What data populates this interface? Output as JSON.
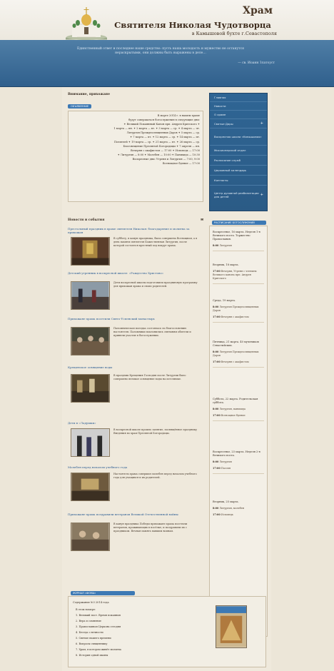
{
  "header": {
    "title": "Храм",
    "name": "Святителя Николая Чудотворца",
    "place": "в Камышовой бухте г.Севастополя",
    "quote": "Единственный ответ и последнее наше средство: пусть наша молодость и мужество не останутся нераскрытыми, они должны быть выражены в деле…",
    "quote_author": "— св. Иоанн Златоуст"
  },
  "notice": {
    "title": "Внимание, прихожане",
    "tab": "ОБЪЯВЛЕНИЕ",
    "lines": [
      "В марте 2014 г. в нашем храме",
      "будут совершаться богослужения в следующие дни:",
      "✦ Великий Покаянный Канон прп. Андрея Критского ✦",
      "1 марта — пн. ✦ 2 марта — вт. ✦ 3 марта — ср. ✦ 4 марта — чт.",
      "Литургия Преждеосвященных Даров ✦ 5 марта — ср.",
      "✦ 7 марта — пт. ✦ 12 марта — ср. ✦ 14 марта — пт.",
      "Полиелей ✦ 19 марта — ср. ✦ 21 марта — пт. ✦ 26 марта — ср.",
      "Благовещение Пресвятой Богородицы ✦ 7 апреля — пн.",
      "Вечерня с акафистом — 17:00 ✦ Исповедь — 17:00",
      "✦ Литургия — 8:00 ✦ Молебен — 10:00 ✦ Панихида — 10:30",
      "Воскресные дни: Утреня и Литургия — 7:00, 9:00",
      "Всенощное бдение — 17:00"
    ]
  },
  "news": {
    "title": "Новости и события",
    "rss": "✉",
    "items": [
      {
        "title": "Престольный праздник в храме святителя Николая: благодарение и молитва за прихожан",
        "text": "В субботу, в канун праздника, была совершена Всенощная, а в день памяти святителя Божественная Литургия, после которой состоялся крестный ход вокруг храма."
      },
      {
        "title": "Детский утренник в воскресной школе: «Рождество Христово»",
        "text": "Дети воскресной школы подготовили праздничную программу для прихожан храма и своих родителей."
      },
      {
        "title": "Прихожане храма посетили Свято-Успенский монастырь",
        "text": "Паломническая поездка состоялась по благословению настоятеля. Паломники поклонились святыням обители и приняли участие в богослужении."
      },
      {
        "title": "Крещенское освящение воды",
        "text": "В праздник Крещения Господня после Литургии было совершено великое освящение воды на источнике."
      },
      {
        "title": "Дети в «Ладушки»",
        "text": "В воскресной школе прошло занятие, посвящённое празднику Введения во храм Пресвятой Богородицы."
      },
      {
        "title": "Молебен перед началом учебного года",
        "text": "Настоятель храма совершил молебен перед началом учебного года для учащихся и их родителей."
      },
      {
        "title": "Прихожане храма поздравили ветеранов Великой Отечественной войны",
        "text": "В канун праздника Победы прихожане храма посетили ветеранов, проживающих в посёлке, и поздравили их с праздником. Вечная память павшим воинам."
      }
    ]
  },
  "nav": {
    "items": [
      {
        "label": "Главная",
        "plus": ""
      },
      {
        "label": "Новости",
        "plus": ""
      },
      {
        "label": "О храме",
        "plus": ""
      },
      {
        "label": "Святые Дары",
        "plus": "+"
      },
      {
        "label": "Воскресная школа «Камышовая»",
        "plus": ""
      },
      {
        "label": "Миссионерский отдел",
        "plus": ""
      },
      {
        "label": "Расписание служб",
        "plus": ""
      },
      {
        "label": "Церковный календарь",
        "plus": ""
      },
      {
        "label": "Контакты",
        "plus": ""
      },
      {
        "label": "Центр духовной реабилитации для детей",
        "plus": "+"
      }
    ]
  },
  "events": {
    "tab": "РАСПИСАНИЕ БОГОСЛУЖЕНИЙ",
    "groups": [
      {
        "head": "Воскресенье, 16 марта. Неделя 1-я Великого поста. Торжество Православия.",
        "times": [
          {
            "t": "8:00",
            "d": "Литургия"
          }
        ]
      },
      {
        "head": "Вторник, 18 марта.",
        "times": [
          {
            "t": "17:00",
            "d": "Вечерня, Утреня с чтением Великого канона прп. Андрея Критского"
          }
        ]
      },
      {
        "head": "Среда, 19 марта.",
        "times": [
          {
            "t": "8:00",
            "d": "Литургия Преждеосвященных Даров"
          },
          {
            "t": "17:00",
            "d": "Вечерня с акафистом"
          }
        ]
      },
      {
        "head": "Пятница, 21 марта. 40 мучеников Севастийских.",
        "times": [
          {
            "t": "8:00",
            "d": "Литургия Преждеосвященных Даров"
          },
          {
            "t": "17:00",
            "d": "Вечерня с акафистом"
          }
        ]
      },
      {
        "head": "Суббота, 22 марта. Родительская суббота.",
        "times": [
          {
            "t": "8:00",
            "d": "Литургия, панихида"
          },
          {
            "t": "17:00",
            "d": "Всенощное бдение"
          }
        ]
      },
      {
        "head": "Воскресенье, 23 марта. Неделя 2-я Великого поста.",
        "times": [
          {
            "t": "8:00",
            "d": "Литургия"
          },
          {
            "t": "17:00",
            "d": "Пассия"
          }
        ]
      },
      {
        "head": "Вторник, 25 марта.",
        "times": [
          {
            "t": "8:00",
            "d": "Литургия, молебен"
          },
          {
            "t": "17:00",
            "d": "Исповедь"
          }
        ]
      }
    ]
  },
  "journal": {
    "tab": "ЖУРНАЛ «ФОМА»",
    "issue": "Содержание №3 2014 года",
    "lines": [
      "В этом номере:",
      "1. Великий пост. Время покаяния",
      "2. Вера и сомнение",
      "3. Православная Церковь сегодня",
      "4. Беседа о вечности",
      "5. Святые нашего времени",
      "6. Вопросы священнику",
      "7. Храм, в котором живёт молитва",
      "8. История одной иконы"
    ]
  }
}
